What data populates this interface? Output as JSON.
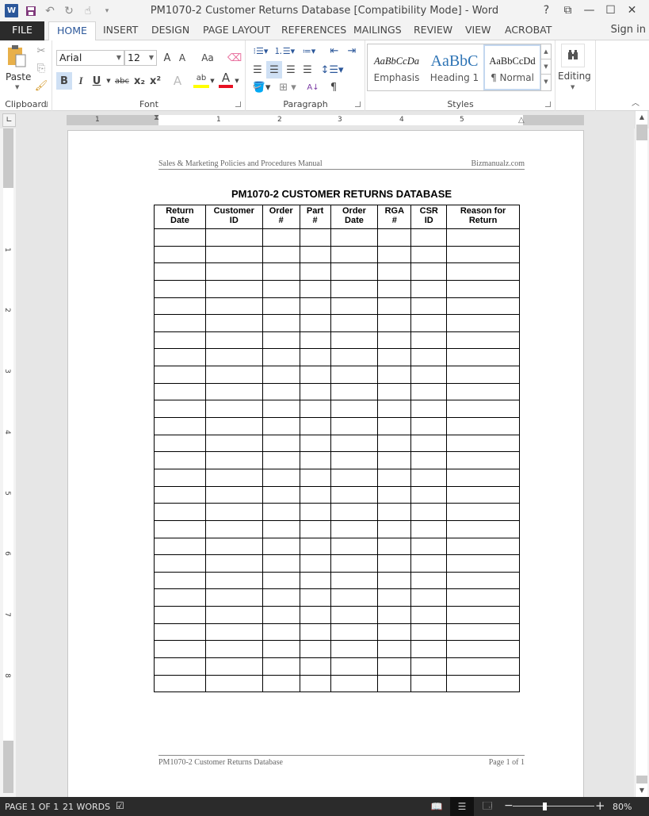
{
  "window": {
    "title": "PM1070-2 Customer Returns Database [Compatibility Mode] - Word",
    "controls": [
      "help-icon",
      "ribbon-display-icon",
      "minimize-icon",
      "maximize-icon",
      "close-icon"
    ],
    "controls_glyphs": {
      "help": "?",
      "ribbon_display": "⧉",
      "minimize": "—",
      "maximize": "☐",
      "close": "✕"
    }
  },
  "qat": {
    "word_logo": "W",
    "save": "💾",
    "undo": "↶",
    "redo": "↻",
    "touch": "☝",
    "customize": "▾"
  },
  "tabs": {
    "items": [
      "FILE",
      "HOME",
      "INSERT",
      "DESIGN",
      "PAGE LAYOUT",
      "REFERENCES",
      "MAILINGS",
      "REVIEW",
      "VIEW",
      "ACROBAT"
    ],
    "active": "HOME",
    "sign_in": "Sign in"
  },
  "ribbon": {
    "clipboard": {
      "label": "Clipboard",
      "paste": "Paste"
    },
    "font": {
      "label": "Font",
      "font_name": "Arial",
      "font_size": "12",
      "grow": "A",
      "shrink": "A",
      "change_case": "Aa",
      "bold": "B",
      "italic": "I",
      "underline": "U",
      "strikethrough": "abc",
      "subscript": "x₂",
      "superscript": "x²",
      "text_effects": "A",
      "highlight": "ab",
      "font_color": "A",
      "highlight_color": "#ffff00",
      "font_color_value": "#e81123"
    },
    "paragraph": {
      "label": "Paragraph",
      "show_marks": "¶",
      "sort": "A↓"
    },
    "styles": {
      "label": "Styles",
      "items": [
        {
          "preview": "AaBbCcDa",
          "name": "Emphasis"
        },
        {
          "preview": "AaBbC",
          "name": "Heading 1"
        },
        {
          "preview": "AaBbCcDd",
          "name": "¶ Normal"
        }
      ],
      "selected": "¶ Normal"
    },
    "editing": {
      "label": "Editing"
    }
  },
  "ruler": {
    "horizontal_numbers": [
      "1",
      "1",
      "2",
      "3",
      "4",
      "5"
    ],
    "vertical_numbers": [
      "1",
      "2",
      "3",
      "4",
      "5",
      "6",
      "7",
      "8"
    ],
    "tab_selector": "∟"
  },
  "document": {
    "header_left": "Sales & Marketing Policies and Procedures Manual",
    "header_right": "Bizmanualz.com",
    "title": "PM1070-2 CUSTOMER RETURNS DATABASE",
    "table": {
      "columns": [
        [
          "Return",
          "Date"
        ],
        [
          "Customer",
          "ID"
        ],
        [
          "Order",
          "#"
        ],
        [
          "Part",
          "#"
        ],
        [
          "Order",
          "Date"
        ],
        [
          "RGA",
          "#"
        ],
        [
          "CSR",
          "ID"
        ],
        [
          "Reason for",
          "Return"
        ]
      ],
      "empty_row_count": 27
    },
    "footer_left": "PM1070-2 Customer Returns Database",
    "footer_right": "Page 1 of 1"
  },
  "statusbar": {
    "page": "PAGE 1 OF 1",
    "words": "21 WORDS",
    "proofing_icon": "📖",
    "zoom_minus": "−",
    "zoom_plus": "+",
    "zoom_level": "80%",
    "zoom_fraction": 0.4
  }
}
